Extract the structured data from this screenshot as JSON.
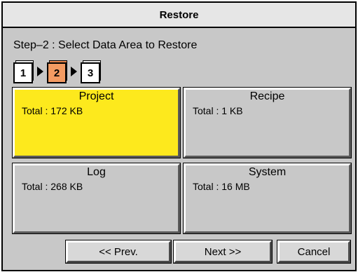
{
  "dialog": {
    "title": "Restore",
    "step_text": "Step–2  :  Select Data Area to Restore"
  },
  "steps": [
    {
      "label": "1",
      "active": false
    },
    {
      "label": "2",
      "active": true
    },
    {
      "label": "3",
      "active": false
    }
  ],
  "areas": [
    {
      "name": "Project",
      "total": "Total  :  172 KB",
      "selected": true
    },
    {
      "name": "Recipe",
      "total": "Total  :  1 KB",
      "selected": false
    },
    {
      "name": "Log",
      "total": "Total  :  268 KB",
      "selected": false
    },
    {
      "name": "System",
      "total": "Total  :  16 MB",
      "selected": false
    }
  ],
  "buttons": {
    "prev": "<<   Prev.",
    "next": "Next   >>",
    "cancel": "Cancel"
  },
  "colors": {
    "selected_tile": "#fde91d",
    "active_step": "#f39b62",
    "panel": "#c8c8c8"
  }
}
